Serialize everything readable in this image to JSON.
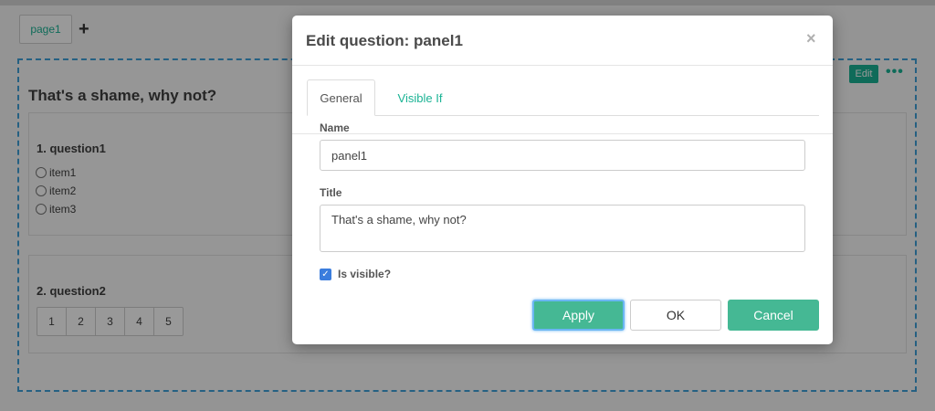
{
  "editor": {
    "page_tab": "page1",
    "add_page": "+",
    "panel_title": "That's a shame, why not?",
    "edit_badge": "Edit",
    "more_dots": "•••",
    "question1": {
      "title": "1. question1",
      "items": [
        "item1",
        "item2",
        "item3"
      ]
    },
    "question2": {
      "title": "2. question2",
      "rating": [
        "1",
        "2",
        "3",
        "4",
        "5"
      ]
    }
  },
  "modal": {
    "title": "Edit question: panel1",
    "close": "×",
    "tabs": {
      "general": "General",
      "visible_if": "Visible If"
    },
    "name_label": "Name",
    "name_value": "panel1",
    "title_label": "Title",
    "title_value": "That's a shame, why not?",
    "is_visible_label": "Is visible?",
    "is_visible_checked": true,
    "buttons": {
      "apply": "Apply",
      "ok": "OK",
      "cancel": "Cancel"
    }
  },
  "colors": {
    "accent": "#1ab394",
    "button_green": "#45b894",
    "focus_blue": "#6bb6f3",
    "checkbox_blue": "#3b7ddd"
  }
}
